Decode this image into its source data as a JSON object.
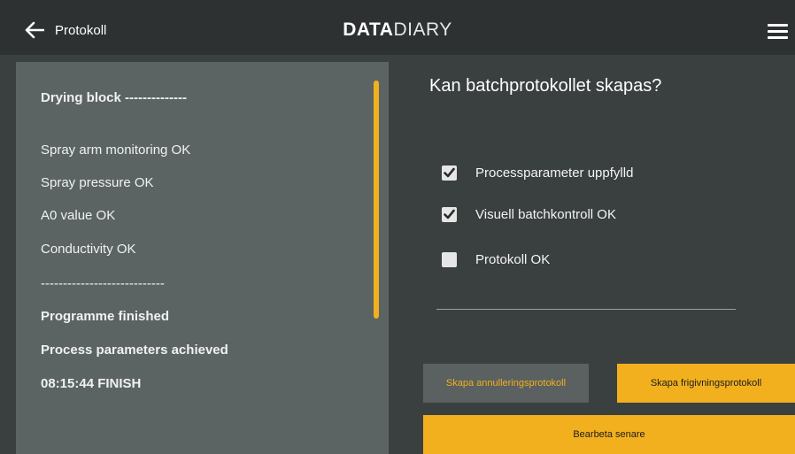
{
  "header": {
    "back_label": "Protokoll",
    "logo_bold": "DATA",
    "logo_thin": "DIARY"
  },
  "log": {
    "lines": [
      {
        "text": "Drying block --------------",
        "bold": true
      },
      {
        "text": "Spray arm monitoring OK",
        "bold": false
      },
      {
        "text": "Spray pressure OK",
        "bold": false
      },
      {
        "text": "A0 value OK",
        "bold": false
      },
      {
        "text": "Conductivity OK",
        "bold": false
      },
      {
        "text": "----------------------------",
        "bold": false
      },
      {
        "text": "Programme finished",
        "bold": true
      },
      {
        "text": "Process parameters achieved",
        "bold": true
      },
      {
        "text": "08:15:44 FINISH",
        "bold": true
      }
    ]
  },
  "question": "Kan batchprotokollet skapas?",
  "checks": [
    {
      "label": "Processparameter uppfylld",
      "checked": true
    },
    {
      "label": "Visuell batchkontroll OK",
      "checked": true
    },
    {
      "label": "Protokoll OK",
      "checked": false
    }
  ],
  "buttons": {
    "cancel_label": "Skapa annulleringsprotokoll",
    "release_label": "Skapa frigivningsprotokoll",
    "later_label": "Bearbeta senare"
  },
  "colors": {
    "accent": "#f2b01e",
    "panel": "#5b6463",
    "background": "#3a3f40",
    "header": "#2d3131"
  }
}
